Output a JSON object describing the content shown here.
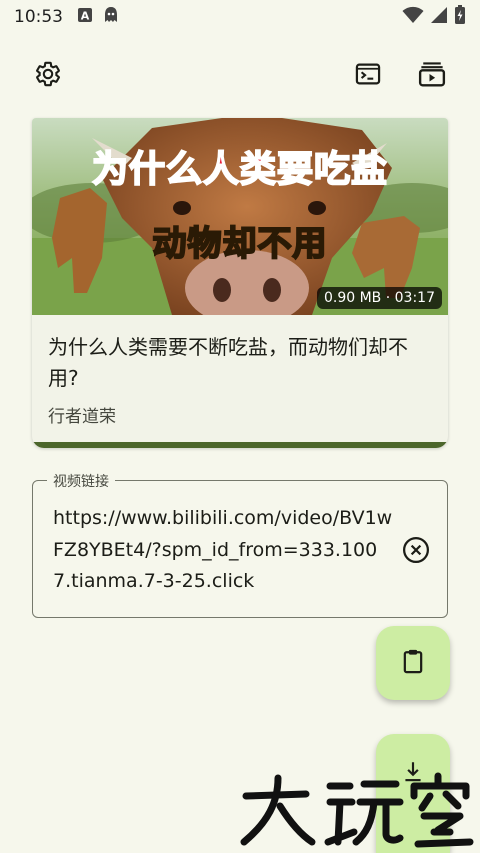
{
  "status": {
    "time": "10:53"
  },
  "toolbar": {
    "settings_icon": "gear-icon",
    "console_icon": "terminal-icon",
    "queue_icon": "video-queue-icon"
  },
  "video": {
    "thumbnail_text_top": "为什么人类要吃盐",
    "thumbnail_text_bottom": "动物却不用",
    "badge": "0.90 MB · 03:17",
    "title": "为什么人类需要不断吃盐，而动物们却不用?",
    "author": "行者道荣",
    "progress": 1.0
  },
  "url_field": {
    "label": "视频链接",
    "value": "https://www.bilibili.com/video/BV1wFZ8YBEt4/?spm_id_from=333.1007.tianma.7-3-25.click"
  },
  "colors": {
    "background": "#f6f7ec",
    "accent": "#4c662b",
    "fab": "#cdeda3"
  }
}
